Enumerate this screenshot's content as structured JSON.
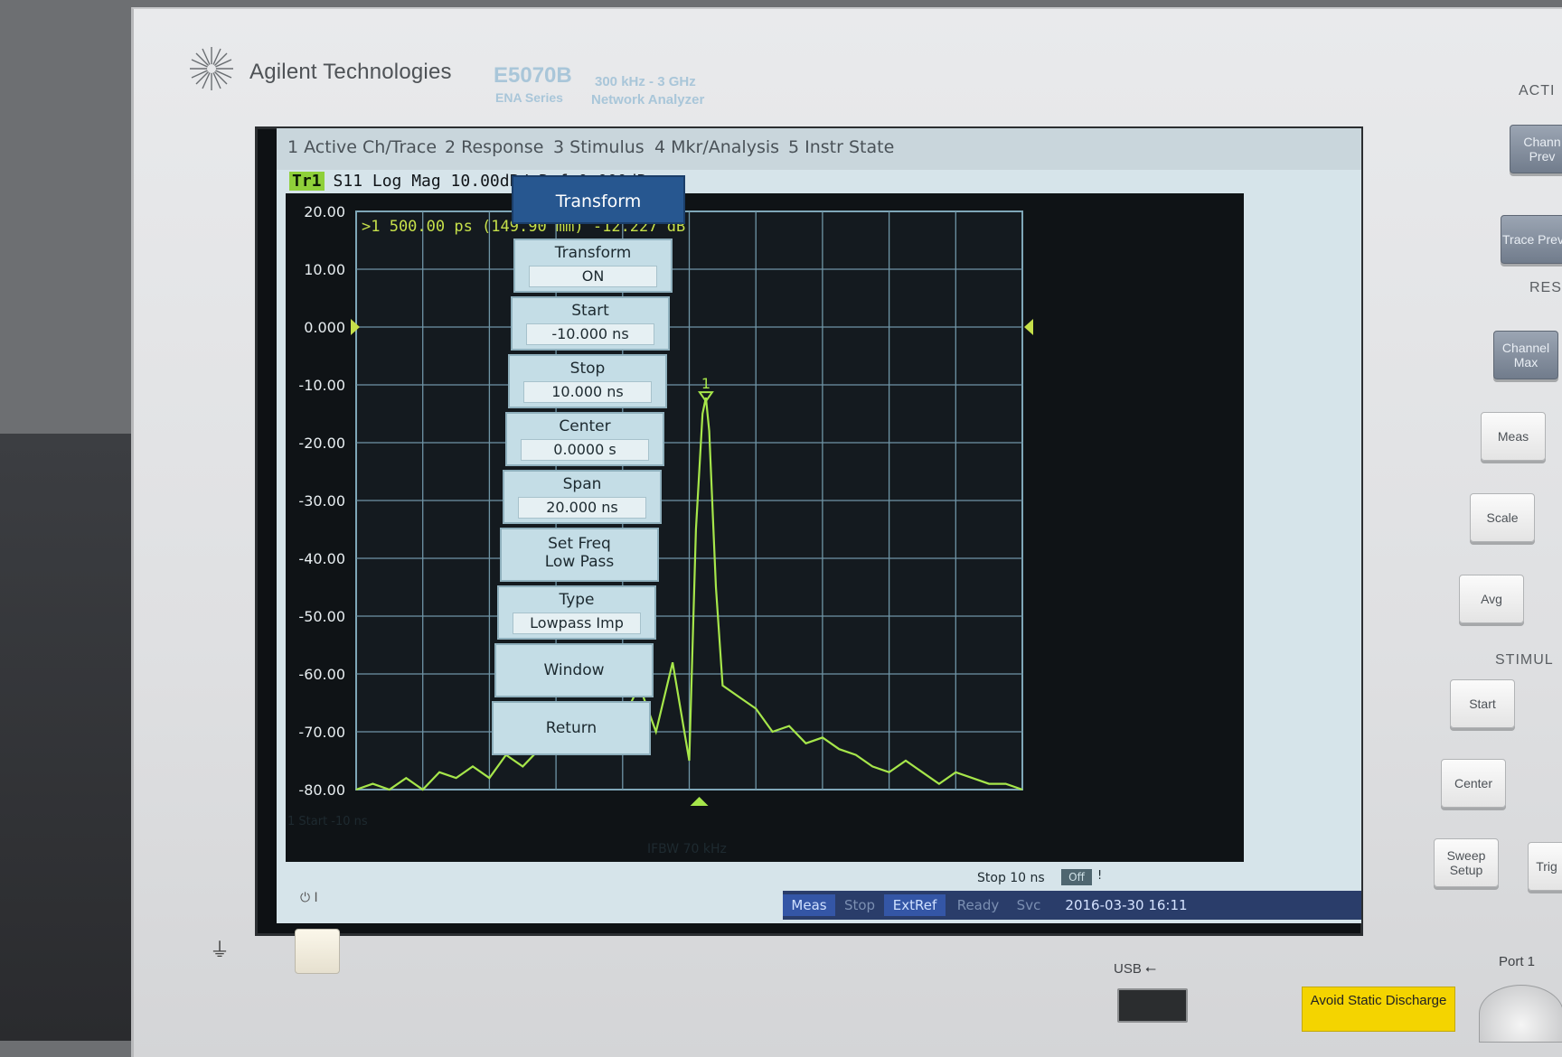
{
  "brand": {
    "name": "Agilent Technologies",
    "model": "E5070B",
    "range": "300 kHz - 3 GHz",
    "series": "ENA  Series",
    "description": "Network Analyzer"
  },
  "menu": [
    "1 Active Ch/Trace",
    "2 Response",
    "3 Stimulus",
    "4 Mkr/Analysis",
    "5 Instr State"
  ],
  "trace": {
    "tag": "Tr1",
    "header": "S11  Log Mag 10.00dB/ Ref 0.000dB"
  },
  "marker": {
    "readout": ">1   500.00 ps (149.90 mm) -12.227 dB",
    "id": "1"
  },
  "axis": {
    "y_ticks": [
      "20.00",
      "10.00",
      "0.000",
      "-10.00",
      "-20.00",
      "-30.00",
      "-40.00",
      "-50.00",
      "-60.00",
      "-70.00",
      "-80.00"
    ]
  },
  "footer": {
    "start": "1  Start -10 ns",
    "ifbw": "IFBW 70 kHz",
    "stop": "Stop 10 ns",
    "off": "Off",
    "excl": "!"
  },
  "status": [
    "Meas",
    "Stop",
    "ExtRef",
    "Ready",
    "Svc",
    "2016-03-30 16:11"
  ],
  "softkeys": {
    "title": "Transform",
    "items": [
      {
        "label": "Transform",
        "value": "ON"
      },
      {
        "label": "Start",
        "value": "-10.000 ns"
      },
      {
        "label": "Stop",
        "value": "10.000 ns"
      },
      {
        "label": "Center",
        "value": "0.0000 s"
      },
      {
        "label": "Span",
        "value": "20.000 ns"
      },
      {
        "label": "Set Freq\nLow Pass",
        "value": ""
      },
      {
        "label": "Type",
        "value": "Lowpass Imp"
      },
      {
        "label": "Window",
        "value": ""
      },
      {
        "label": "Return",
        "value": ""
      }
    ]
  },
  "panel": {
    "labels": [
      "ACTI",
      "RES",
      "STIMUL"
    ],
    "keys": [
      {
        "label": "Chann Prev"
      },
      {
        "label": "Trace Prev"
      },
      {
        "label": "Channel Max"
      },
      {
        "label": "Meas"
      },
      {
        "label": "Scale"
      },
      {
        "label": "Avg"
      },
      {
        "label": "Start"
      },
      {
        "label": "Center"
      },
      {
        "label": "Sweep Setup"
      },
      {
        "label": "Trig"
      }
    ],
    "usb": "USB",
    "port": "Port 1",
    "static": "Avoid Static Discharge"
  },
  "chart_data": {
    "type": "line",
    "title": "",
    "xlabel": "",
    "ylabel": "",
    "xlim": [
      -10,
      10
    ],
    "ylim": [
      -80,
      20
    ],
    "y_ticks": [
      20,
      10,
      0,
      -10,
      -20,
      -30,
      -40,
      -50,
      -60,
      -70,
      -80
    ],
    "series": [
      {
        "x": [
          -10,
          -9.5,
          -9,
          -8.5,
          -8,
          -7.5,
          -7,
          -6.5,
          -6,
          -5.5,
          -5,
          -4.5,
          -4,
          -3.5,
          -3,
          -2.5,
          -2,
          -1.5,
          -1,
          -0.5,
          0,
          0.2,
          0.4,
          0.5,
          0.6,
          0.8,
          1,
          1.5,
          2,
          2.5,
          3,
          3.5,
          4,
          4.5,
          5,
          5.5,
          6,
          6.5,
          7,
          7.5,
          8,
          8.5,
          9,
          9.5,
          10
        ],
        "y": [
          -80,
          -79,
          -80,
          -78,
          -80,
          -77,
          -78,
          -76,
          -78,
          -74,
          -76,
          -73,
          -72,
          -69,
          -71,
          -67,
          -68,
          -62,
          -70,
          -58,
          -75,
          -35,
          -15,
          -12.2,
          -18,
          -45,
          -62,
          -64,
          -66,
          -70,
          -69,
          -72,
          -71,
          -73,
          -74,
          -76,
          -77,
          -75,
          -77,
          -79,
          -77,
          -78,
          -79,
          -79,
          -80
        ]
      }
    ]
  }
}
